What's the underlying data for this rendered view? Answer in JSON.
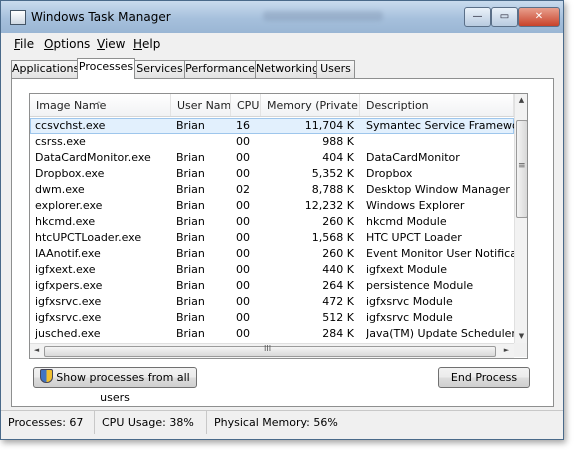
{
  "window": {
    "title": "Windows Task Manager",
    "caption_buttons": {
      "minimize": "—",
      "maximize": "▭",
      "close": "✕"
    }
  },
  "menu": [
    {
      "label": "File",
      "mnemonic": "F",
      "rest": "ile"
    },
    {
      "label": "Options",
      "mnemonic": "O",
      "rest": "ptions"
    },
    {
      "label": "View",
      "mnemonic": "V",
      "rest": "iew"
    },
    {
      "label": "Help",
      "mnemonic": "H",
      "rest": "elp"
    }
  ],
  "tabs": [
    "Applications",
    "Processes",
    "Services",
    "Performance",
    "Networking",
    "Users"
  ],
  "active_tab": "Processes",
  "columns": [
    "Image Name",
    "User Name",
    "CPU",
    "Memory (Private ...",
    "Description"
  ],
  "rows": [
    {
      "image": "ccsvchst.exe",
      "user": "Brian",
      "cpu": "16",
      "mem": "11,704 K",
      "desc": "Symantec Service Framework"
    },
    {
      "image": "csrss.exe",
      "user": "",
      "cpu": "00",
      "mem": "988 K",
      "desc": ""
    },
    {
      "image": "DataCardMonitor.exe",
      "user": "Brian",
      "cpu": "00",
      "mem": "404 K",
      "desc": "DataCardMonitor"
    },
    {
      "image": "Dropbox.exe",
      "user": "Brian",
      "cpu": "00",
      "mem": "5,352 K",
      "desc": "Dropbox"
    },
    {
      "image": "dwm.exe",
      "user": "Brian",
      "cpu": "02",
      "mem": "8,788 K",
      "desc": "Desktop Window Manager"
    },
    {
      "image": "explorer.exe",
      "user": "Brian",
      "cpu": "00",
      "mem": "12,232 K",
      "desc": "Windows Explorer"
    },
    {
      "image": "hkcmd.exe",
      "user": "Brian",
      "cpu": "00",
      "mem": "260 K",
      "desc": "hkcmd Module"
    },
    {
      "image": "htcUPCTLoader.exe",
      "user": "Brian",
      "cpu": "00",
      "mem": "1,568 K",
      "desc": "HTC UPCT Loader"
    },
    {
      "image": "IAAnotif.exe",
      "user": "Brian",
      "cpu": "00",
      "mem": "260 K",
      "desc": "Event Monitor User Notification T"
    },
    {
      "image": "igfxext.exe",
      "user": "Brian",
      "cpu": "00",
      "mem": "440 K",
      "desc": "igfxext Module"
    },
    {
      "image": "igfxpers.exe",
      "user": "Brian",
      "cpu": "00",
      "mem": "264 K",
      "desc": "persistence Module"
    },
    {
      "image": "igfxsrvc.exe",
      "user": "Brian",
      "cpu": "00",
      "mem": "472 K",
      "desc": "igfxsrvc Module"
    },
    {
      "image": "igfxsrvc.exe",
      "user": "Brian",
      "cpu": "00",
      "mem": "512 K",
      "desc": "igfxsrvc Module"
    },
    {
      "image": "jusched.exe",
      "user": "Brian",
      "cpu": "00",
      "mem": "284 K",
      "desc": "Java(TM) Update Scheduler"
    }
  ],
  "selected_row": 0,
  "buttons": {
    "show_all": "Show processes from all users",
    "end_process": "End Process"
  },
  "status": {
    "processes": "Processes: 67",
    "cpu_usage": "CPU Usage: 38%",
    "physical_memory": "Physical Memory: 56%"
  },
  "scroll_glyphs": {
    "up": "▲",
    "down": "▼",
    "left": "◄",
    "right": "►",
    "grip_v": "≡",
    "grip_h": "III"
  },
  "colors": {
    "selection": "#e2f0fd",
    "titlebar": "#a6c0dc",
    "close": "#c8422a"
  }
}
